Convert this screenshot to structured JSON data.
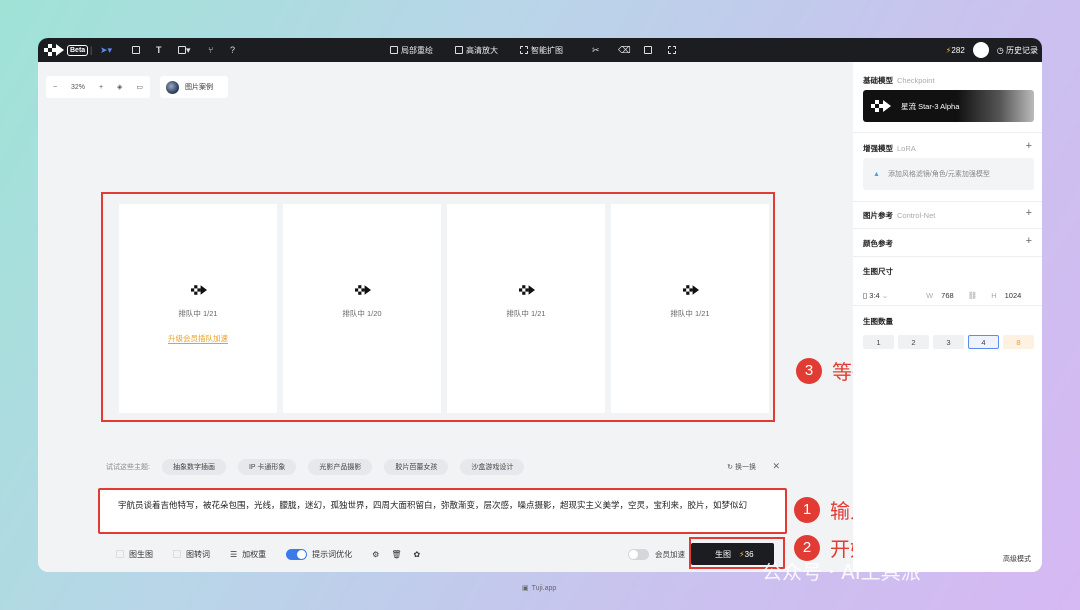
{
  "topbar": {
    "beta": "Beta",
    "tools": [
      "局部重绘",
      "高清放大",
      "智能扩图"
    ],
    "credits": "282",
    "history": "历史记录"
  },
  "canvas": {
    "zoom": "32%",
    "example_button": "图片案例",
    "cards": [
      {
        "status": "排队中 1/21",
        "upgrade": "升级会员插队加速"
      },
      {
        "status": "排队中 1/20"
      },
      {
        "status": "排队中 1/21"
      },
      {
        "status": "排队中 1/21"
      }
    ]
  },
  "annotations": [
    {
      "num": "3",
      "text": "等待生成完成"
    },
    {
      "num": "1",
      "text": "输入提示词"
    },
    {
      "num": "2",
      "text": "开始生成图片"
    }
  ],
  "topics": {
    "label": "试试这些主题:",
    "chips": [
      "抽象数字插画",
      "IP 卡通形象",
      "光影产品摄影",
      "胶片芭蕾女孩",
      "沙盒游戏设计"
    ],
    "swap": "换一换"
  },
  "prompt": {
    "text": "宇航员谈着吉他特写，被花朵包围，光线，朦胧，迷幻，孤独世界，四周大面积留白，弥散渐变，层次感，噪点摄影，超现实主义美学，空灵，宝利来，胶片，如梦似幻"
  },
  "toolbar": {
    "img2img": "图生图",
    "img2text": "图转词",
    "weight": "加权重",
    "optimize": "提示词优化",
    "optimize_on": true,
    "member_speed": "会员加速",
    "generate": "生图",
    "generate_cost": "36",
    "advanced": "高级模式"
  },
  "sidebar": {
    "base_model": {
      "title": "基础模型",
      "sub": "Checkpoint",
      "name": "星流 Star-3 Alpha"
    },
    "lora": {
      "title": "增强模型",
      "sub": "LoRA",
      "placeholder": "添加风格滤镜/角色/元素加强模型"
    },
    "image_ref": {
      "title": "图片参考",
      "sub": "Control-Net"
    },
    "color_ref": {
      "title": "颜色参考"
    },
    "size": {
      "title": "生图尺寸",
      "ratio": "3:4",
      "w_label": "W",
      "w": "768",
      "h_label": "H",
      "h": "1024"
    },
    "count": {
      "title": "生图数量",
      "options": [
        "1",
        "2",
        "3",
        "4",
        "8"
      ],
      "selected": "4"
    }
  },
  "footer": {
    "site": "Tuji.app"
  },
  "watermark": {
    "text": "公众号 · AI工具派"
  }
}
